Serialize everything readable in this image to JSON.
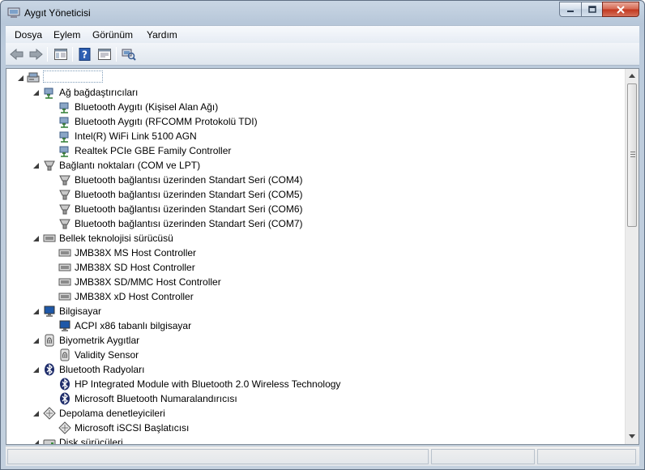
{
  "window": {
    "title": "Aygıt Yöneticisi"
  },
  "menu": [
    "Dosya",
    "Eylem",
    "Görünüm",
    "Yardım"
  ],
  "toolbar": {
    "buttons": [
      "back-icon",
      "forward-icon",
      "show-hide-console-tree-icon",
      "help-icon",
      "properties-icon",
      "scan-hardware-changes-icon"
    ]
  },
  "tree": {
    "root": {
      "label": "",
      "icon": "computer-icon"
    },
    "categories": [
      {
        "label": "Ağ bağdaştırıcıları",
        "icon": "network-adapter-icon",
        "children": [
          "Bluetooth Aygıtı (Kişisel Alan Ağı)",
          "Bluetooth Aygıtı (RFCOMM Protokolü TDI)",
          "Intel(R) WiFi Link 5100 AGN",
          "Realtek PCIe GBE Family Controller"
        ]
      },
      {
        "label": "Bağlantı noktaları (COM ve LPT)",
        "icon": "port-icon",
        "children": [
          "Bluetooth bağlantısı üzerinden Standart Seri (COM4)",
          "Bluetooth bağlantısı üzerinden Standart Seri (COM5)",
          "Bluetooth bağlantısı üzerinden Standart Seri (COM6)",
          "Bluetooth bağlantısı üzerinden Standart Seri (COM7)"
        ]
      },
      {
        "label": "Bellek teknolojisi sürücüsü",
        "icon": "memory-controller-icon",
        "children": [
          "JMB38X MS Host Controller",
          "JMB38X SD Host Controller",
          "JMB38X SD/MMC Host Controller",
          "JMB38X xD Host Controller"
        ]
      },
      {
        "label": "Bilgisayar",
        "icon": "monitor-computer-icon",
        "children": [
          "ACPI x86 tabanlı bilgisayar"
        ]
      },
      {
        "label": "Biyometrik Aygıtlar",
        "icon": "fingerprint-icon",
        "children": [
          "Validity Sensor"
        ]
      },
      {
        "label": "Bluetooth Radyoları",
        "icon": "bluetooth-icon",
        "children": [
          "HP Integrated Module with Bluetooth 2.0 Wireless Technology",
          "Microsoft Bluetooth Numaralandırıcısı"
        ]
      },
      {
        "label": "Depolama denetleyicileri",
        "icon": "storage-controller-icon",
        "children": [
          "Microsoft iSCSI Başlatıcısı"
        ]
      },
      {
        "label": "Disk sürücüleri",
        "icon": "disk-drive-icon",
        "children": []
      }
    ]
  }
}
